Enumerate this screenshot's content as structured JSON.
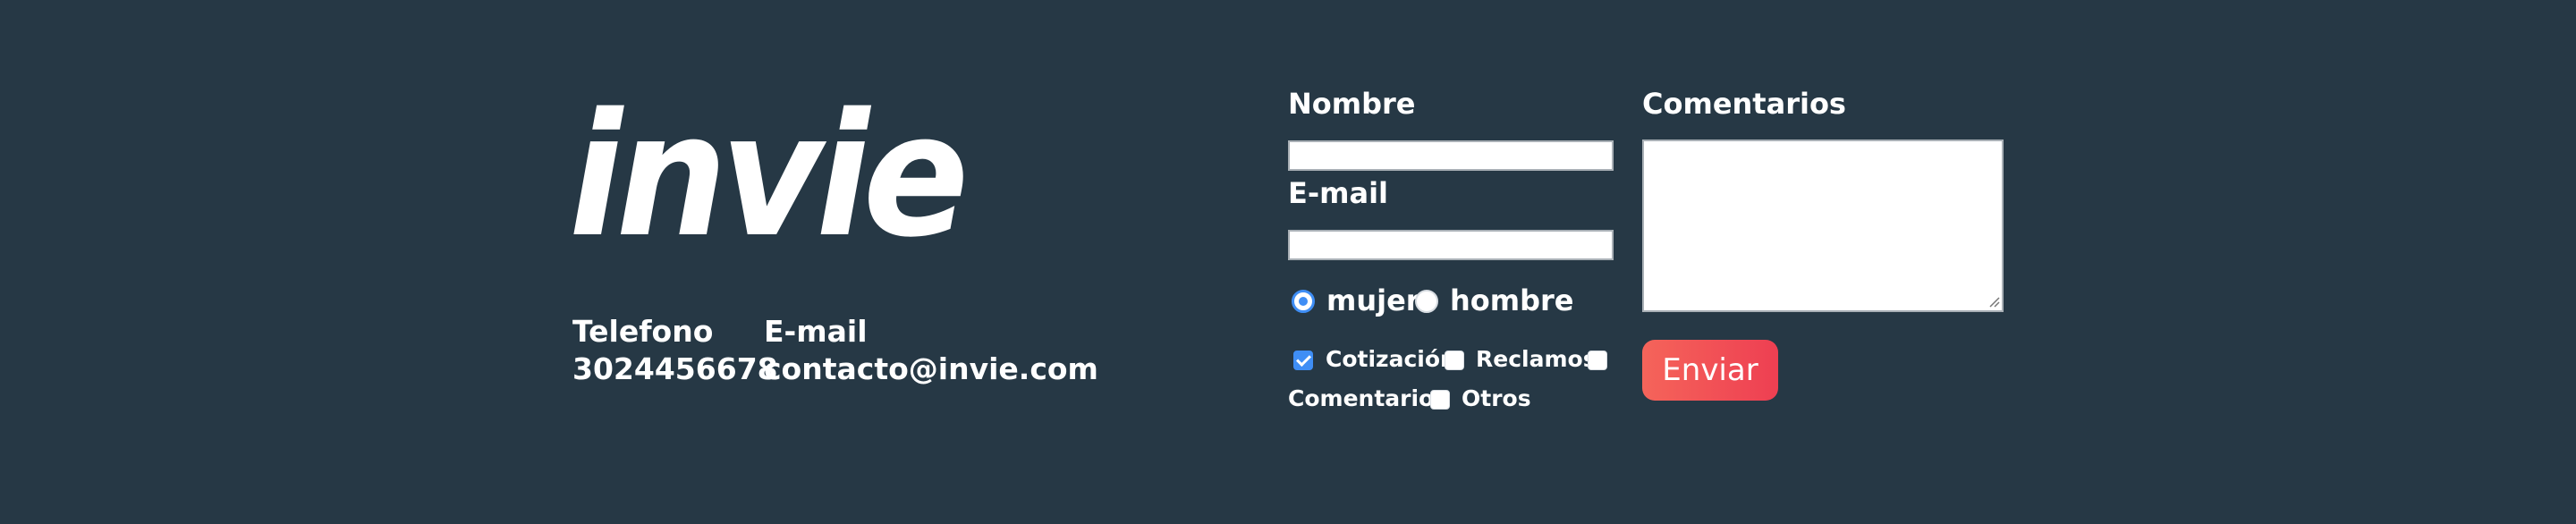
{
  "brand": {
    "logo_text": "invie"
  },
  "contact": {
    "phone_label": "Telefono",
    "phone_value": "3024456678",
    "email_label": "E-mail",
    "email_value": "contacto@invie.com"
  },
  "form": {
    "name_label": "Nombre",
    "name_value": "",
    "email_label": "E-mail",
    "email_value": "",
    "comments_label": "Comentarios",
    "comments_value": "",
    "gender_options": [
      {
        "label": "mujer",
        "checked": true
      },
      {
        "label": "hombre",
        "checked": false
      }
    ],
    "topic_options": [
      {
        "label": "Cotización",
        "checked": true
      },
      {
        "label": "Reclamos",
        "checked": false
      },
      {
        "label": "Comentarios",
        "checked": false
      },
      {
        "label": "Otros",
        "checked": false
      }
    ],
    "submit_label": "Enviar"
  },
  "colors": {
    "background": "#263845",
    "accent_blue": "#3f8ef5",
    "button_gradient_start": "#f5645a",
    "button_gradient_end": "#ee3f52"
  }
}
